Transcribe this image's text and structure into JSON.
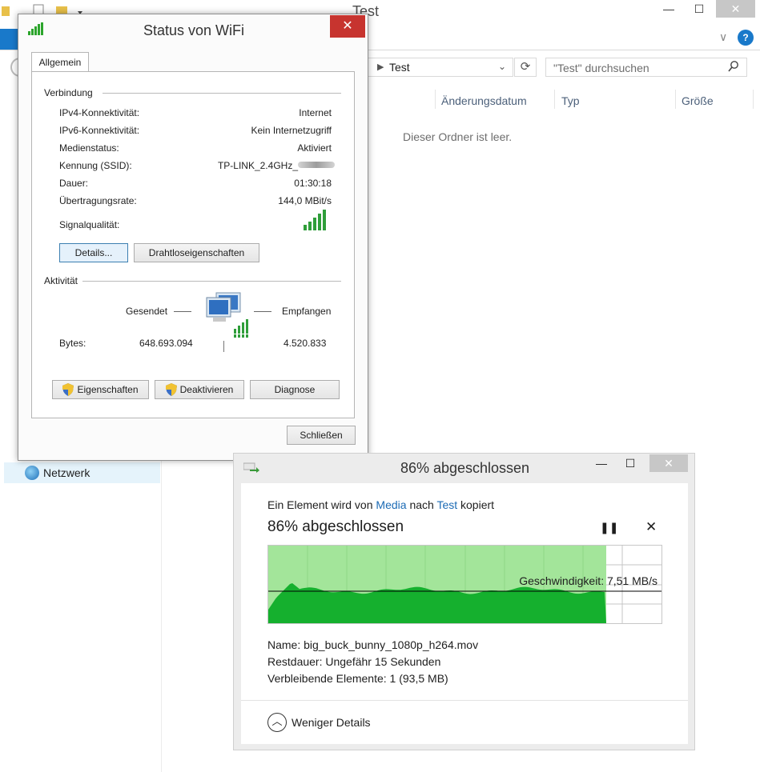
{
  "explorer": {
    "title": "Test",
    "address": "Test",
    "search_placeholder": "\"Test\" durchsuchen",
    "columns": [
      "Änderungsdatum",
      "Typ",
      "Größe"
    ],
    "empty_text": "Dieser Ordner ist leer.",
    "nav_item": "Netzwerk",
    "win_min": "—",
    "win_max": "☐",
    "win_close": "✕",
    "chevron": "∨",
    "help": "?"
  },
  "wifi": {
    "title": "Status von WiFi",
    "close": "✕",
    "tab": "Allgemein",
    "group_connection": "Verbindung",
    "rows": [
      {
        "label": "IPv4-Konnektivität:",
        "value": "Internet"
      },
      {
        "label": "IPv6-Konnektivität:",
        "value": "Kein Internetzugriff"
      },
      {
        "label": "Medienstatus:",
        "value": "Aktiviert"
      },
      {
        "label": "Kennung (SSID):",
        "value": "TP-LINK_2.4GHz_"
      },
      {
        "label": "Dauer:",
        "value": "01:30:18"
      },
      {
        "label": "Übertragungsrate:",
        "value": "144,0 MBit/s"
      }
    ],
    "signal_label": "Signalqualität:",
    "btn_details": "Details...",
    "btn_wireless": "Drahtloseigenschaften",
    "group_activity": "Aktivität",
    "sent_label": "Gesendet",
    "received_label": "Empfangen",
    "bytes_label": "Bytes:",
    "bytes_sent": "648.693.094",
    "bytes_received": "4.520.833",
    "btn_properties": "Eigenschaften",
    "btn_disable": "Deaktivieren",
    "btn_diagnose": "Diagnose",
    "btn_close": "Schließen"
  },
  "copy": {
    "title": "86% abgeschlossen",
    "line_prefix": "Ein Element wird von",
    "source": "Media",
    "line_middle": "nach",
    "dest": "Test",
    "line_suffix": "kopiert",
    "heading": "86% abgeschlossen",
    "progress_fraction": 0.86,
    "speed_label": "Geschwindigkeit: 7,51 MB/s",
    "name_line": "Name:  big_buck_bunny_1080p_h264.mov",
    "remaining_line": "Restdauer:  Ungefähr 15 Sekunden",
    "items_line": "Verbleibende Elemente:  1 (93,5 MB)",
    "less_details": "Weniger Details",
    "pause": "❚❚",
    "cancel": "✕",
    "win_min": "—",
    "win_max": "☐",
    "win_close": "✕",
    "colors": {
      "fill_light": "#a3e59a",
      "fill_dark": "#15b02e",
      "grid": "#c6c6c6"
    }
  }
}
